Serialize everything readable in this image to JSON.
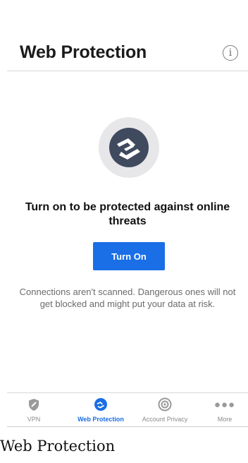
{
  "header": {
    "title": "Web Protection",
    "info_icon": "info-icon"
  },
  "hero": {
    "icon": "web-protection-shield-icon",
    "headline": "Turn on to be protected against online threats",
    "button_label": "Turn On",
    "description": "Connections aren't scanned. Dangerous ones will not get blocked and might put your data at risk."
  },
  "tabs": [
    {
      "label": "VPN",
      "icon": "vpn-shield-icon",
      "active": false
    },
    {
      "label": "Web Protection",
      "icon": "web-protection-icon",
      "active": true
    },
    {
      "label": "Account Privacy",
      "icon": "account-privacy-icon",
      "active": false
    },
    {
      "label": "More",
      "icon": "more-dots-icon",
      "active": false
    }
  ],
  "caption": "Web Protection",
  "colors": {
    "accent": "#1a6ee6",
    "icon_dark": "#3f4a5e",
    "icon_bg": "#e7e7ea",
    "muted_text": "#6b6b6b"
  }
}
